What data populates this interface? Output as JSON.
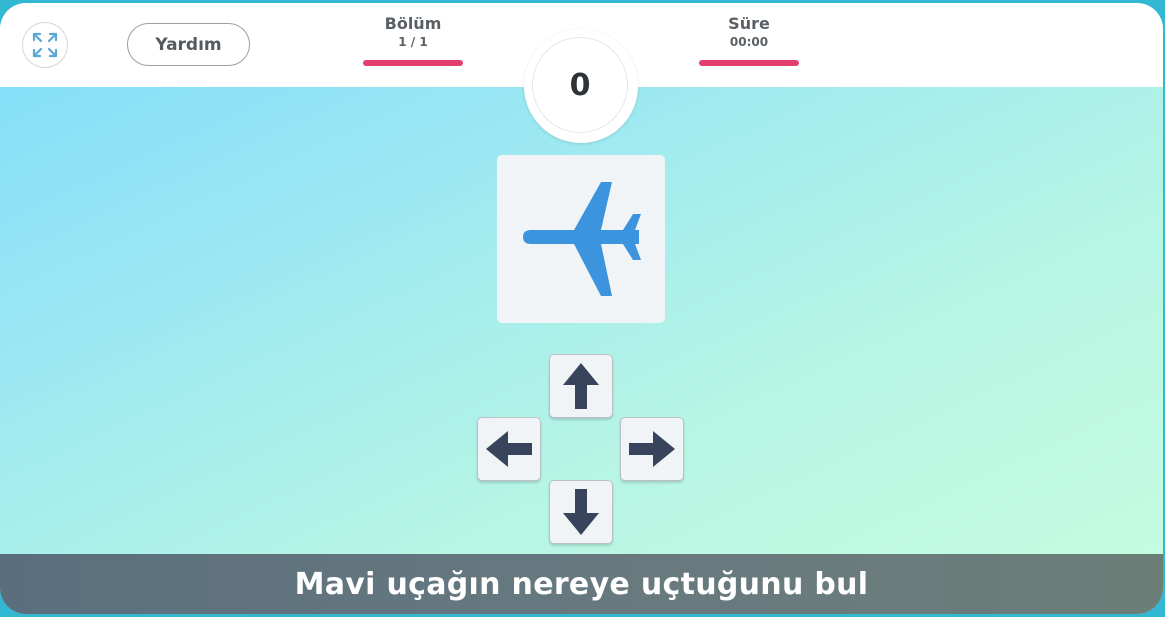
{
  "header": {
    "help_label": "Yardım",
    "level": {
      "label": "Bölüm",
      "value": "1 / 1"
    },
    "time": {
      "label": "Süre",
      "value": "00:00"
    }
  },
  "score": "0",
  "target": {
    "icon": "airplane-icon",
    "direction": "left",
    "color": "#3d94de"
  },
  "controls": {
    "up": "arrow-up-icon",
    "left": "arrow-left-icon",
    "right": "arrow-right-icon",
    "down": "arrow-down-icon",
    "arrow_color": "#38445c"
  },
  "instruction": "Mavi uçağın nereye uçtuğunu bul",
  "colors": {
    "accent_bar": "#e23f6c",
    "fullscreen_icon": "#5aa7d6"
  }
}
